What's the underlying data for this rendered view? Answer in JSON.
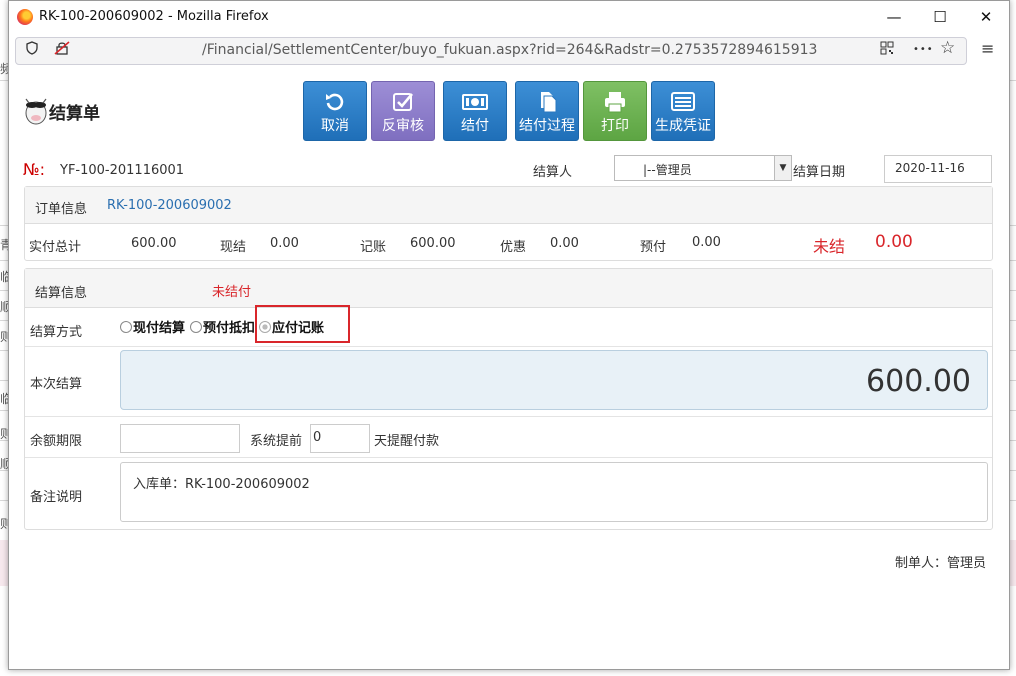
{
  "window": {
    "title": "RK-100-200609002 - Mozilla Firefox",
    "url": "/Financial/SettlementCenter/buyo_fukuan.aspx?rid=264&Radstr=0.2753572894615913",
    "minimize_symbol": "—",
    "maximize_symbol": "☐",
    "close_symbol": "✕",
    "menu_symbol": "≡",
    "more_symbol": "•••",
    "bookmark_symbol": "☆"
  },
  "background_chars": [
    "频",
    "青",
    "临",
    "顺",
    "则",
    "临",
    "则",
    "顺",
    "则"
  ],
  "header": {
    "title": "结算单"
  },
  "toolbar": {
    "cancel": "取消",
    "unreview": "反审核",
    "settle": "结付",
    "settle_process": "结付过程",
    "print": "打印",
    "voucher": "生成凭证"
  },
  "doc": {
    "no_label": "№:",
    "no_value": "YF-100-201116001",
    "settler_label": "结算人",
    "settler_value": "|--管理员",
    "date_label": "结算日期",
    "date_value": "2020-11-16"
  },
  "order": {
    "label": "订单信息",
    "value": "RK-100-200609002",
    "total_label": "实付总计",
    "total_value": "600.00",
    "cash_label": "现结",
    "cash_value": "0.00",
    "account_label": "记账",
    "account_value": "600.00",
    "discount_label": "优惠",
    "discount_value": "0.00",
    "prepay_label": "预付",
    "prepay_value": "0.00",
    "unsettled_label": "未结",
    "unsettled_value": "0.00"
  },
  "settlement": {
    "label": "结算信息",
    "status": "未结付",
    "method_label": "结算方式",
    "methods": [
      "现付结算",
      "预付抵扣",
      "应付记账"
    ],
    "selected_method": "应付记账",
    "this_label": "本次结算",
    "this_value": "600.00",
    "balance_label": "余额期限",
    "balance_value": "",
    "remind_prefix": "系统提前",
    "remind_value": "0",
    "remind_suffix": "天提醒付款",
    "remark_label": "备注说明",
    "remark_value": "入库单：RK-100-200609002"
  },
  "footer": {
    "maker": "制单人：管理员"
  },
  "colors": {
    "accent_blue": "#1f6fb8",
    "accent_purple": "#7f6fc0",
    "accent_green": "#5da543",
    "alert_red": "#d9262b"
  }
}
